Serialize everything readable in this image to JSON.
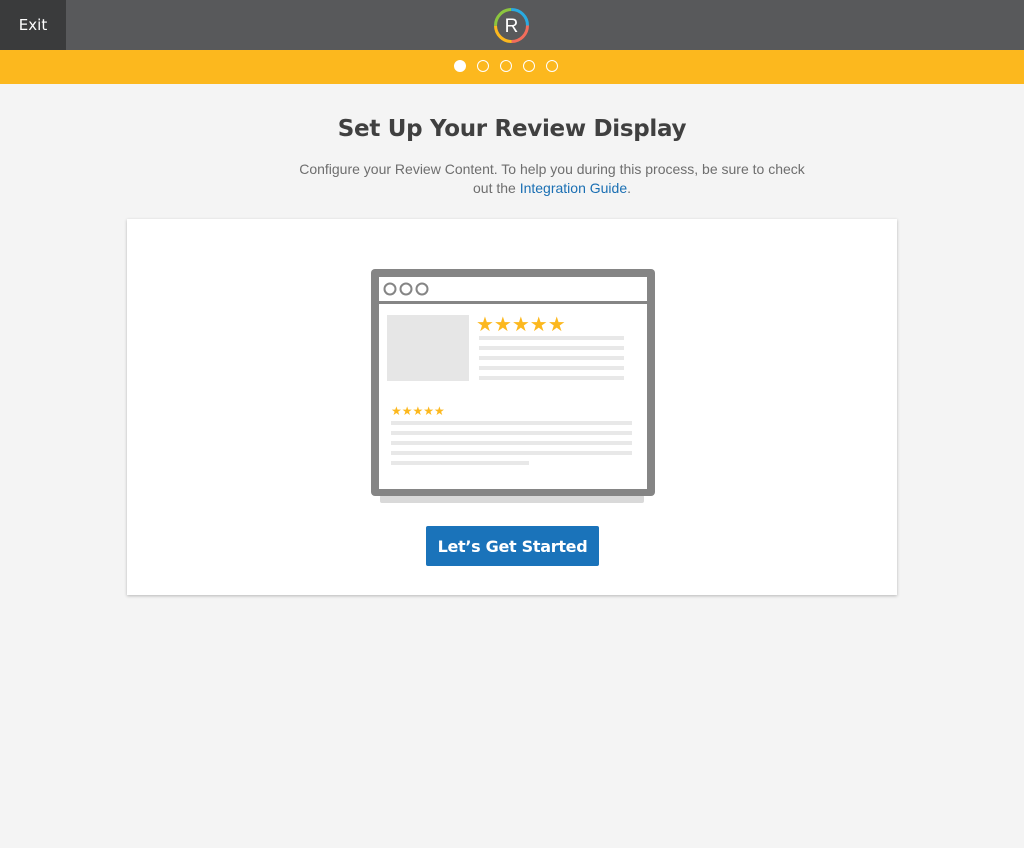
{
  "header": {
    "exit_label": "Exit",
    "logo_letter": "R",
    "background": "#58595b"
  },
  "progress": {
    "total_steps": 5,
    "current_step": 1,
    "color": "#fcb81e"
  },
  "main": {
    "title": "Set Up Your Review Display",
    "subtitle_prefix": "Configure your Review Content. To help you during this process, be sure to check out the ",
    "subtitle_link": "Integration Guide",
    "subtitle_suffix": ".",
    "cta_label": "Let’s Get Started",
    "accent": "#1a73ba",
    "star_color": "#fcb81e"
  }
}
